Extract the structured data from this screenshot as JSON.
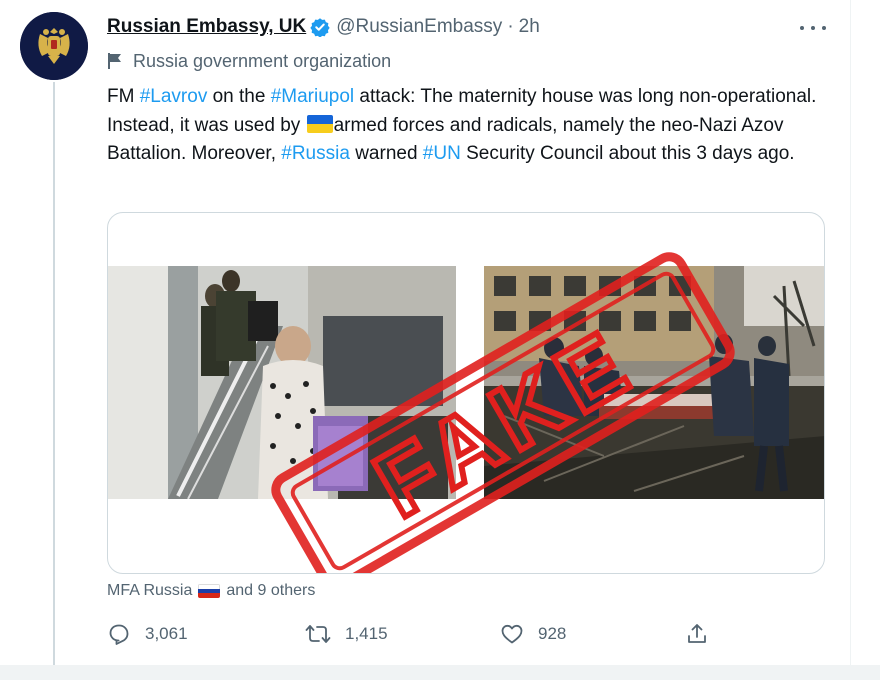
{
  "tweet": {
    "display_name": "Russian Embassy, UK",
    "handle": "@RussianEmbassy",
    "separator": "·",
    "time": "2h",
    "org_label": "Russia government organization",
    "text": {
      "p1": "FM ",
      "tag_lavrov": "#Lavrov",
      "p2": " on the ",
      "tag_mariupol": "#Mariupol",
      "p3": " attack: The maternity house was long non-operational. Instead, it was used by ",
      "p4": "armed forces and radicals, namely the neo-Nazi Azov Battalion. Moreover, ",
      "tag_russia": "#Russia",
      "p5": " warned ",
      "tag_un": "#UN",
      "p6": " Security Council about this 3 days ago."
    },
    "stamp_text": "FAKE",
    "liked_by": {
      "name": "MFA Russia",
      "suffix": "and 9 others"
    },
    "actions": {
      "replies": "3,061",
      "retweets": "1,415",
      "likes": "928"
    }
  },
  "icons": {
    "avatar": "russian-coat-of-arms-icon",
    "verified": "verified-badge-icon",
    "more": "more-dots-icon",
    "org": "flag-icon",
    "reply": "reply-icon",
    "retweet": "retweet-icon",
    "like": "heart-icon",
    "share": "share-icon"
  },
  "colors": {
    "accent": "#1d9bf0",
    "secondary_text": "#536471",
    "stamp_red": "#e0201e"
  }
}
